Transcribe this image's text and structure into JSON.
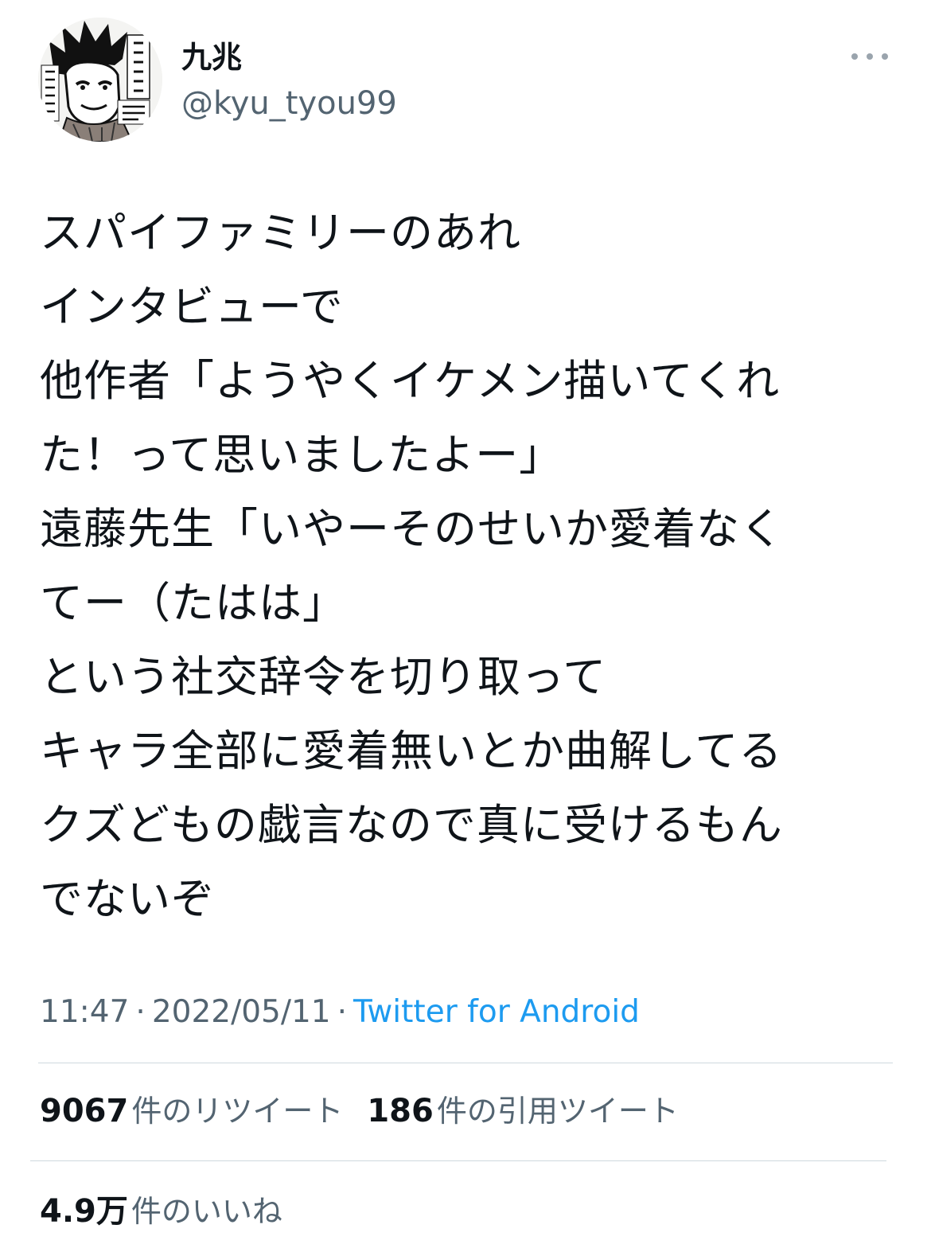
{
  "author": {
    "display_name": "九兆",
    "handle": "@kyu_tyou99",
    "avatar_icon": "manga-portrait-avatar"
  },
  "more_icon": "more-dots-icon",
  "tweet": {
    "lines": [
      "スパイファミリーのあれ",
      "インタビューで",
      "他作者「ようやくイケメン描いてくれ",
      "た！って思いましたよー」",
      "遠藤先生「いやーそのせいか愛着なく",
      "てー（たはは」",
      "という社交辞令を切り取って",
      "キャラ全部に愛着無いとか曲解してる",
      "クズどもの戯言なので真に受けるもん",
      "でないぞ"
    ]
  },
  "meta": {
    "time": "11:47",
    "separator": "·",
    "date": "2022/05/11",
    "source": "Twitter for Android"
  },
  "stats": {
    "retweets": {
      "count": "9067",
      "label": "件のリツイート"
    },
    "quotes": {
      "count": "186",
      "label": "件の引用ツイート"
    },
    "likes": {
      "count": "4.9万",
      "label": "件のいいね"
    }
  },
  "colors": {
    "text": "#0f1419",
    "secondary": "#536471",
    "link": "#1d9bf0",
    "divider": "#cfd9de"
  }
}
